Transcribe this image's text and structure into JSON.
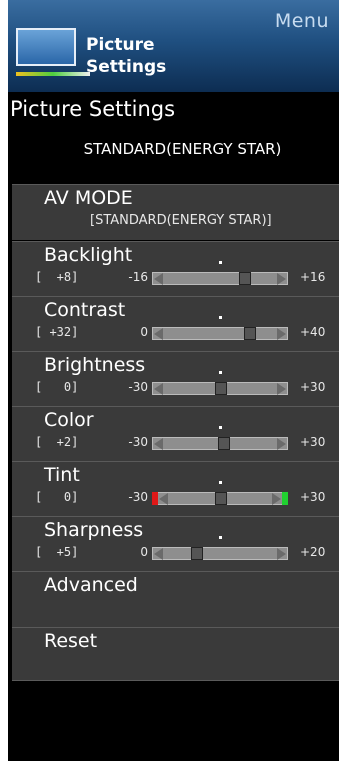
{
  "header": {
    "menu_label": "Menu",
    "title_line1": "Picture",
    "title_line2": "Settings"
  },
  "subtitle": "Picture Settings",
  "current_mode": "STANDARD(ENERGY STAR)",
  "av_mode": {
    "label": "AV MODE",
    "value": "[STANDARD(ENERGY STAR)]"
  },
  "sliders": [
    {
      "label": "Backlight",
      "value_text": "[  +8]",
      "value": 8,
      "min": -16,
      "max": 16,
      "min_text": "-16",
      "max_text": "+16"
    },
    {
      "label": "Contrast",
      "value_text": "[ +32]",
      "value": 32,
      "min": 0,
      "max": 40,
      "min_text": "0",
      "max_text": "+40"
    },
    {
      "label": "Brightness",
      "value_text": "[   0]",
      "value": 0,
      "min": -30,
      "max": 30,
      "min_text": "-30",
      "max_text": "+30"
    },
    {
      "label": "Color",
      "value_text": "[  +2]",
      "value": 2,
      "min": -30,
      "max": 30,
      "min_text": "-30",
      "max_text": "+30"
    },
    {
      "label": "Tint",
      "value_text": "[   0]",
      "value": 0,
      "min": -30,
      "max": 30,
      "min_text": "-30",
      "max_text": "+30",
      "left_color": "#e01818",
      "right_color": "#20d030"
    },
    {
      "label": "Sharpness",
      "value_text": "[  +5]",
      "value": 5,
      "min": 0,
      "max": 20,
      "min_text": "0",
      "max_text": "+20"
    }
  ],
  "menu_items": [
    {
      "label": "Advanced"
    },
    {
      "label": "Reset"
    }
  ]
}
